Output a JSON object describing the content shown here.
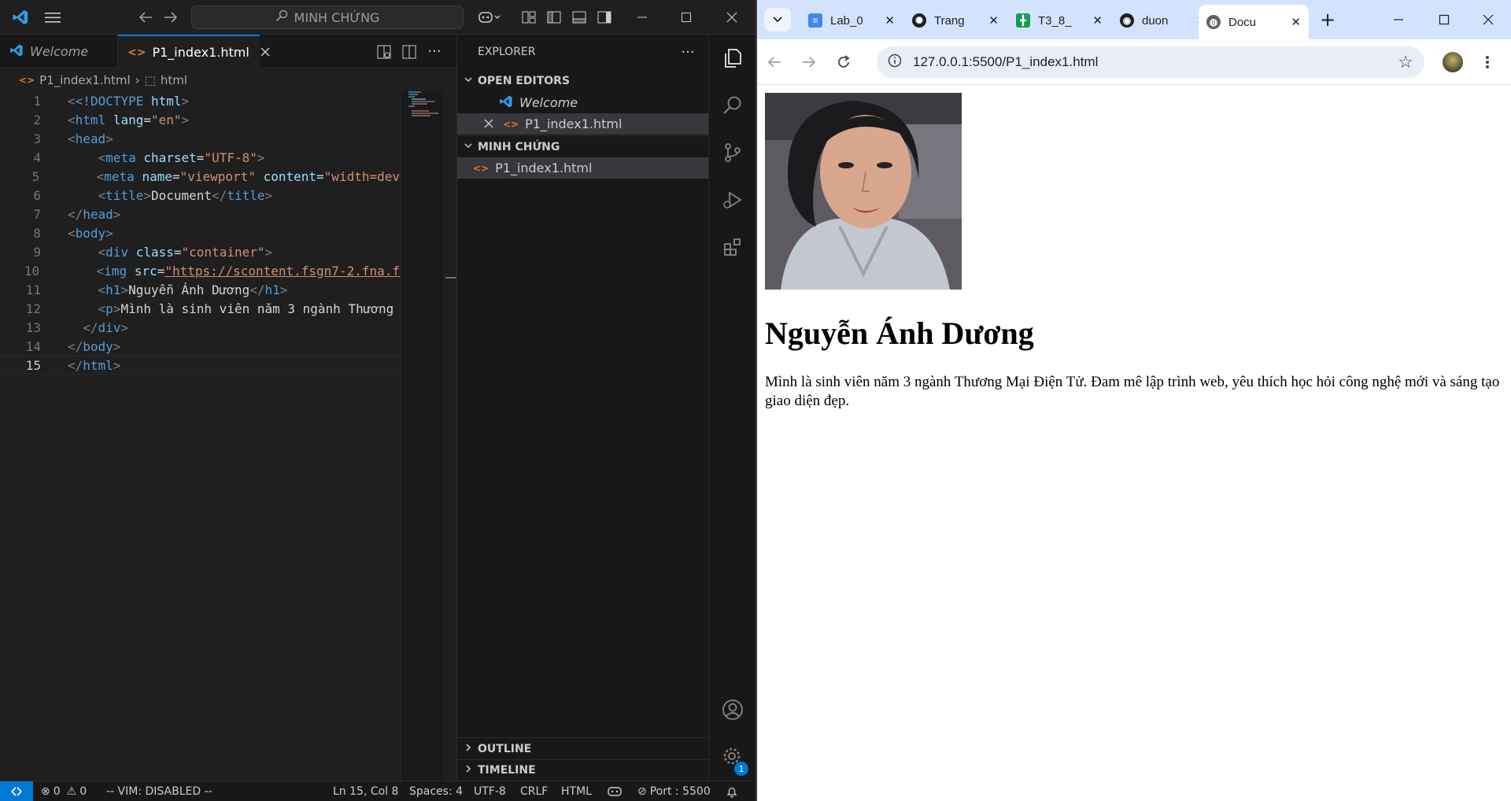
{
  "vscode": {
    "search_label": "MINH CHỨNG",
    "tabs": [
      {
        "label": "Welcome"
      },
      {
        "label": "P1_index1.html"
      }
    ],
    "breadcrumb": {
      "file": "P1_index1.html",
      "symbol": "html"
    },
    "code_lines": [
      {
        "n": "1"
      },
      {
        "n": "2"
      },
      {
        "n": "3"
      },
      {
        "n": "4"
      },
      {
        "n": "5"
      },
      {
        "n": "6"
      },
      {
        "n": "7"
      },
      {
        "n": "8"
      },
      {
        "n": "9"
      },
      {
        "n": "10"
      },
      {
        "n": "11"
      },
      {
        "n": "12"
      },
      {
        "n": "13"
      },
      {
        "n": "14"
      },
      {
        "n": "15"
      }
    ],
    "code": {
      "l1_doctype": "<!DOCTYPE",
      "l1_html": "html",
      "l2_lang": "\"en\"",
      "l4_charset": "\"UTF-8\"",
      "l5_name": "\"viewport\"",
      "l5_content": "\"width=dev",
      "l6_text": "Document",
      "l9_class": "\"container\"",
      "l10_src": "\"https://scontent.fsgn7-2.fna.f",
      "l11_text": "Nguyễn Ánh Dương",
      "l12_text": "Mình là sinh viên năm 3 ngành Thương"
    },
    "explorer": {
      "title": "EXPLORER",
      "open_editors": "OPEN EDITORS",
      "open_items": [
        "Welcome",
        "P1_index1.html"
      ],
      "folder": "MINH CHỨNG",
      "folder_items": [
        "P1_index1.html"
      ],
      "outline": "OUTLINE",
      "timeline": "TIMELINE"
    },
    "status": {
      "errors": "0",
      "warnings": "0",
      "vim": "-- VIM: DISABLED --",
      "position": "Ln 15, Col 8",
      "spaces": "Spaces: 4",
      "encoding": "UTF-8",
      "eol": "CRLF",
      "language": "HTML",
      "port": "Port : 5500",
      "accounts_badge": "1"
    }
  },
  "chrome": {
    "tabs": [
      {
        "label": "Lab_0",
        "icon": "google-docs-icon"
      },
      {
        "label": "Trang",
        "icon": "chatgpt-icon"
      },
      {
        "label": "T3_8_",
        "icon": "google-sheets-icon"
      },
      {
        "label": "duon",
        "icon": "github-icon"
      },
      {
        "label": "Docu",
        "icon": "globe-icon"
      }
    ],
    "url": "127.0.0.1:5500/P1_index1.html"
  },
  "page": {
    "heading": "Nguyễn Ánh Dương",
    "paragraph": "Mình là sinh viên năm 3 ngành Thương Mại Điện Tử. Đam mê lập trình web, yêu thích học hỏi công nghệ mới và sáng tạo giao diện đẹp."
  },
  "colors": {
    "vscode_blue": "#0078d4",
    "tag": "#569cd6",
    "attr": "#9cdcfe",
    "string": "#ce9178",
    "chrome_tabstrip": "#d3e3fd"
  }
}
